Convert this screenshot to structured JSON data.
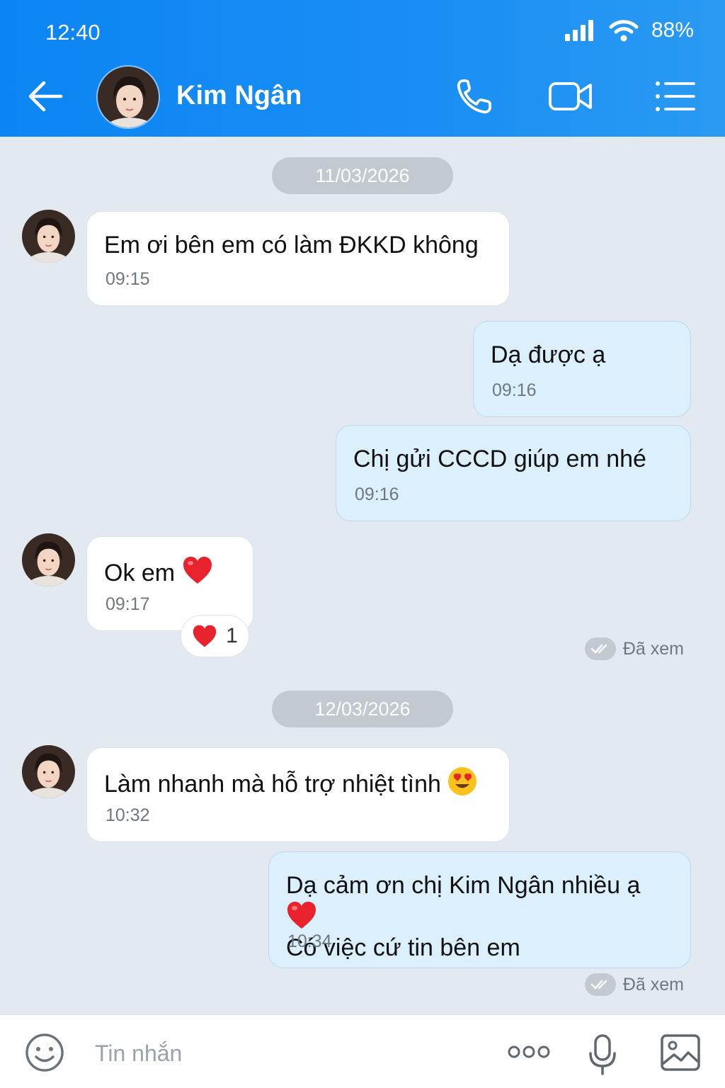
{
  "status_bar": {
    "time": "12:40",
    "battery": "88%"
  },
  "header": {
    "contact_name": "Kim Ngân"
  },
  "conversation": {
    "date_1": "11/03/2026",
    "date_2": "12/03/2026",
    "messages": [
      {
        "text": "Em ơi bên em có làm ĐKKD không",
        "time": "09:15"
      },
      {
        "text": "Dạ được ạ",
        "time": "09:16"
      },
      {
        "text": "Chị gửi CCCD giúp em nhé",
        "time": "09:16"
      },
      {
        "text": "Ok em",
        "time": "09:17",
        "reaction_count": "1"
      },
      {
        "text": "Làm nhanh mà hỗ trợ nhiệt tình",
        "time": "10:32"
      },
      {
        "text_line1": "Dạ cảm ơn chị Kim Ngân nhiều ạ",
        "text_line2": "Có việc cứ tin bên em",
        "time": "10:34"
      }
    ],
    "seen_label": "Đã xem"
  },
  "composer": {
    "placeholder": "Tin nhắn"
  },
  "icons": [
    "back-arrow-icon",
    "phone-icon",
    "video-call-icon",
    "menu-list-icon",
    "heart-icon",
    "heart-eyes-emoji-icon",
    "seen-check-icon",
    "emoji-icon",
    "more-icon",
    "microphone-icon",
    "image-icon",
    "signal-icon",
    "wifi-icon"
  ],
  "colors": {
    "header": "#0b85f3",
    "incoming_bubble": "#ffffff",
    "outgoing_bubble": "#dbeffd",
    "background": "#e3e9f1",
    "heart": "#e8232e"
  }
}
